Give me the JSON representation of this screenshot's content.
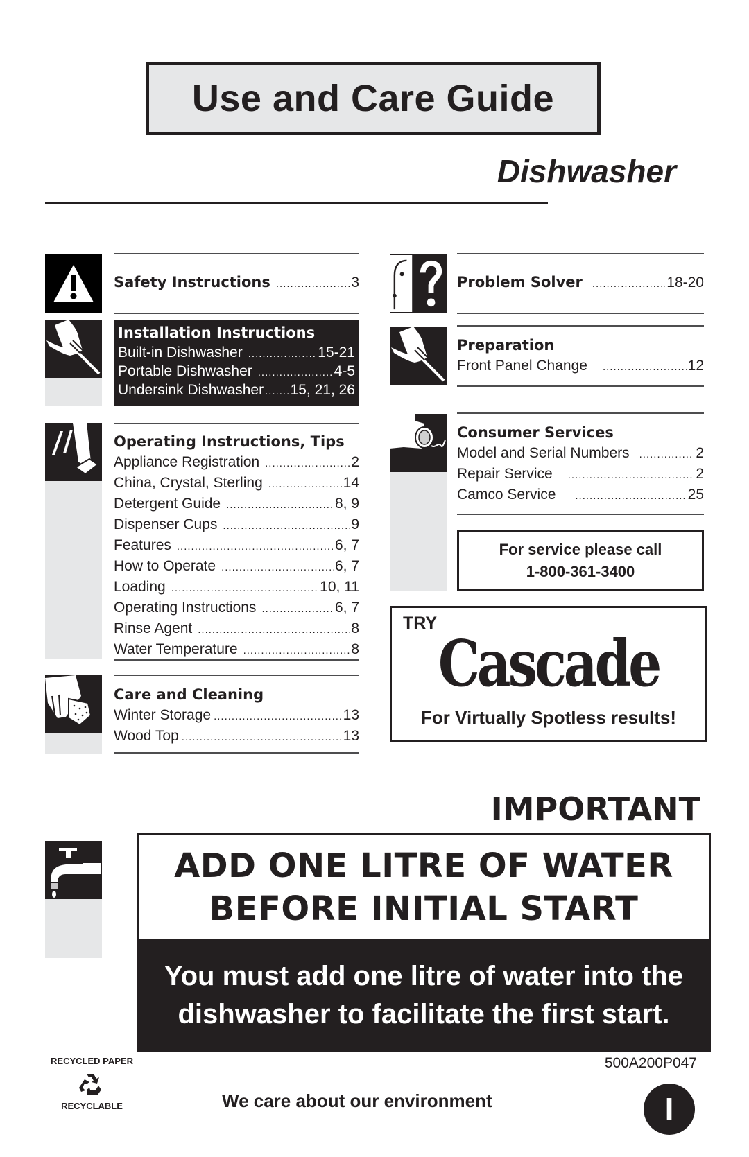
{
  "header": {
    "title": "Use and Care Guide",
    "subtitle": "Dishwasher"
  },
  "toc": {
    "safety": {
      "icon": "warning-triangle-icon",
      "title": "Safety Instructions",
      "page": "3"
    },
    "installation": {
      "icon": "hand-screwdriver-icon",
      "title": "Installation Instructions",
      "items": [
        {
          "label": "Built-in Dishwasher",
          "page": "15-21"
        },
        {
          "label": "Portable Dishwasher",
          "page": "4-5"
        },
        {
          "label": "Undersink Dishwasher",
          "page": "15, 21, 26"
        }
      ]
    },
    "operating": {
      "icon": "finger-pressing-button-icon",
      "title": "Operating Instructions, Tips",
      "items": [
        {
          "label": "Appliance Registration",
          "page": "2"
        },
        {
          "label": "China, Crystal, Sterling",
          "page": "14"
        },
        {
          "label": "Detergent Guide",
          "page": "8, 9"
        },
        {
          "label": "Dispenser Cups",
          "page": "9"
        },
        {
          "label": "Features",
          "page": "6, 7"
        },
        {
          "label": "How to Operate",
          "page": "6, 7"
        },
        {
          "label": "Loading",
          "page": "10, 11"
        },
        {
          "label": "Operating Instructions",
          "page": "6, 7"
        },
        {
          "label": "Rinse Agent",
          "page": "8"
        },
        {
          "label": "Water Temperature",
          "page": "8"
        }
      ]
    },
    "care": {
      "icon": "hand-sponge-icon",
      "title": "Care and Cleaning",
      "items": [
        {
          "label": "Winter Storage",
          "page": "13"
        },
        {
          "label": "Wood Top",
          "page": "13"
        }
      ]
    },
    "problem": {
      "icon": "face-question-mark-icon",
      "title": "Problem Solver",
      "page": "18-20"
    },
    "preparation": {
      "icon": "hand-screwdriver-icon",
      "title": "Preparation",
      "items": [
        {
          "label": "Front Panel Change",
          "page": "12"
        }
      ]
    },
    "consumer": {
      "icon": "telephone-handset-icon",
      "title": "Consumer Services",
      "items": [
        {
          "label": "Model and Serial Numbers",
          "page": "2"
        },
        {
          "label": "Repair Service",
          "page": "2"
        },
        {
          "label": "Camco Service",
          "page": "25"
        }
      ]
    }
  },
  "service": {
    "line1": "For service please call",
    "phone": "1-800-361-3400"
  },
  "promo": {
    "try": "TRY",
    "brand": "Cascade",
    "tagline": "For Virtually Spotless results!"
  },
  "important": {
    "heading": "IMPORTANT",
    "icon": "water-faucet-icon",
    "line1": "ADD ONE LITRE OF WATER",
    "line2": "BEFORE INITIAL START",
    "sub1": "You must add one litre of water into the",
    "sub2": "dishwasher to facilitate the first start."
  },
  "footer": {
    "recycled_paper": "RECYCLED PAPER",
    "recyclable": "RECYCLABLE",
    "environment": "We care about our environment",
    "doc_code": "500A200P047",
    "language_badge": "I"
  },
  "colors": {
    "ink": "#231f20",
    "panel_grey": "#e6e7e8",
    "paper": "#ffffff"
  }
}
